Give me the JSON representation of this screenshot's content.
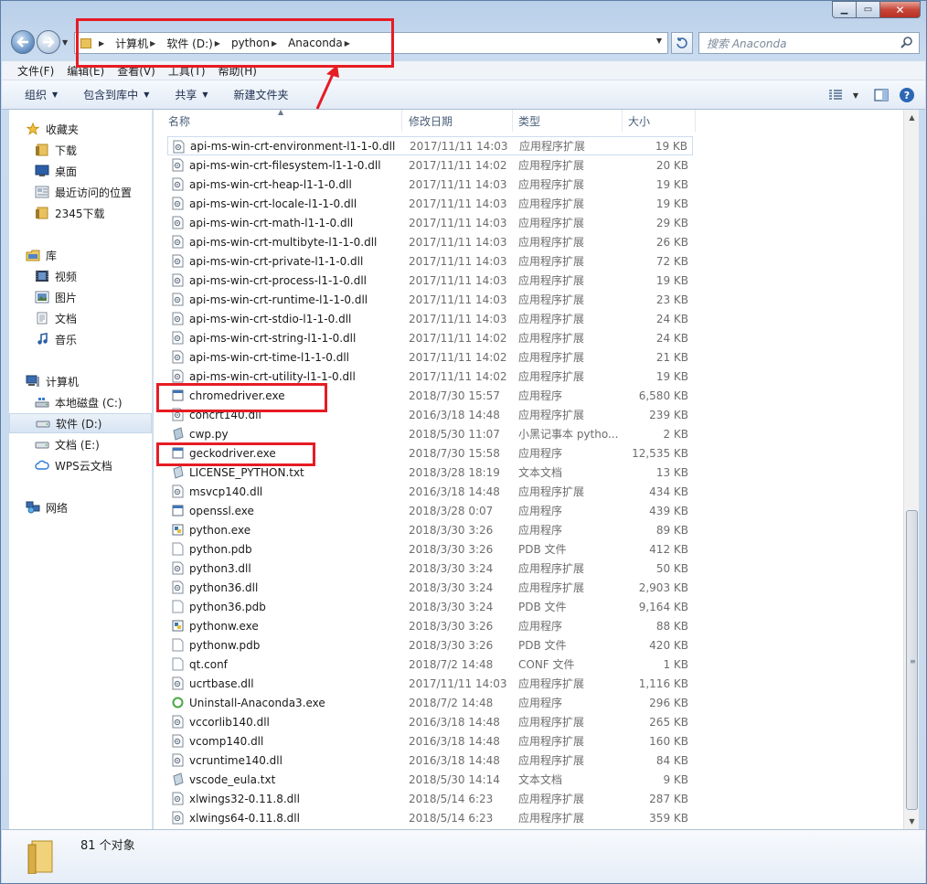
{
  "window": {
    "controls": {
      "minimize": "▁",
      "maximize": "▭",
      "close": "✕"
    }
  },
  "address": {
    "crumbs": [
      "计算机",
      "软件 (D:)",
      "python",
      "Anaconda"
    ],
    "search_placeholder": "搜索 Anaconda"
  },
  "menu": [
    "文件(F)",
    "编辑(E)",
    "查看(V)",
    "工具(T)",
    "帮助(H)"
  ],
  "commands": [
    "组织",
    "包含到库中",
    "共享",
    "新建文件夹"
  ],
  "nav": {
    "favorites": {
      "label": "收藏夹",
      "items": [
        "下载",
        "桌面",
        "最近访问的位置",
        "2345下载"
      ]
    },
    "library": {
      "label": "库",
      "items": [
        "视频",
        "图片",
        "文档",
        "音乐"
      ]
    },
    "computer": {
      "label": "计算机",
      "items": [
        "本地磁盘 (C:)",
        "软件 (D:)",
        "文档 (E:)",
        "WPS云文档"
      ]
    },
    "network": {
      "label": "网络"
    }
  },
  "columns": [
    "名称",
    "修改日期",
    "类型",
    "大小"
  ],
  "files": [
    {
      "name": "api-ms-win-crt-environment-l1-1-0.dll",
      "date": "2017/11/11 14:03",
      "type": "应用程序扩展",
      "size": "19 KB",
      "icon": "dll"
    },
    {
      "name": "api-ms-win-crt-filesystem-l1-1-0.dll",
      "date": "2017/11/11 14:02",
      "type": "应用程序扩展",
      "size": "20 KB",
      "icon": "dll"
    },
    {
      "name": "api-ms-win-crt-heap-l1-1-0.dll",
      "date": "2017/11/11 14:03",
      "type": "应用程序扩展",
      "size": "19 KB",
      "icon": "dll"
    },
    {
      "name": "api-ms-win-crt-locale-l1-1-0.dll",
      "date": "2017/11/11 14:03",
      "type": "应用程序扩展",
      "size": "19 KB",
      "icon": "dll"
    },
    {
      "name": "api-ms-win-crt-math-l1-1-0.dll",
      "date": "2017/11/11 14:03",
      "type": "应用程序扩展",
      "size": "29 KB",
      "icon": "dll"
    },
    {
      "name": "api-ms-win-crt-multibyte-l1-1-0.dll",
      "date": "2017/11/11 14:03",
      "type": "应用程序扩展",
      "size": "26 KB",
      "icon": "dll"
    },
    {
      "name": "api-ms-win-crt-private-l1-1-0.dll",
      "date": "2017/11/11 14:03",
      "type": "应用程序扩展",
      "size": "72 KB",
      "icon": "dll"
    },
    {
      "name": "api-ms-win-crt-process-l1-1-0.dll",
      "date": "2017/11/11 14:03",
      "type": "应用程序扩展",
      "size": "19 KB",
      "icon": "dll"
    },
    {
      "name": "api-ms-win-crt-runtime-l1-1-0.dll",
      "date": "2017/11/11 14:03",
      "type": "应用程序扩展",
      "size": "23 KB",
      "icon": "dll"
    },
    {
      "name": "api-ms-win-crt-stdio-l1-1-0.dll",
      "date": "2017/11/11 14:03",
      "type": "应用程序扩展",
      "size": "24 KB",
      "icon": "dll"
    },
    {
      "name": "api-ms-win-crt-string-l1-1-0.dll",
      "date": "2017/11/11 14:02",
      "type": "应用程序扩展",
      "size": "24 KB",
      "icon": "dll"
    },
    {
      "name": "api-ms-win-crt-time-l1-1-0.dll",
      "date": "2017/11/11 14:02",
      "type": "应用程序扩展",
      "size": "21 KB",
      "icon": "dll"
    },
    {
      "name": "api-ms-win-crt-utility-l1-1-0.dll",
      "date": "2017/11/11 14:02",
      "type": "应用程序扩展",
      "size": "19 KB",
      "icon": "dll"
    },
    {
      "name": "chromedriver.exe",
      "date": "2018/7/30 15:57",
      "type": "应用程序",
      "size": "6,580 KB",
      "icon": "exe"
    },
    {
      "name": "concrt140.dll",
      "date": "2016/3/18 14:48",
      "type": "应用程序扩展",
      "size": "239 KB",
      "icon": "dll"
    },
    {
      "name": "cwp.py",
      "date": "2018/5/30 11:07",
      "type": "小黑记事本 pytho...",
      "size": "2 KB",
      "icon": "py"
    },
    {
      "name": "geckodriver.exe",
      "date": "2018/7/30 15:58",
      "type": "应用程序",
      "size": "12,535 KB",
      "icon": "exe"
    },
    {
      "name": "LICENSE_PYTHON.txt",
      "date": "2018/3/28 18:19",
      "type": "文本文档",
      "size": "13 KB",
      "icon": "txt"
    },
    {
      "name": "msvcp140.dll",
      "date": "2016/3/18 14:48",
      "type": "应用程序扩展",
      "size": "434 KB",
      "icon": "dll"
    },
    {
      "name": "openssl.exe",
      "date": "2018/3/28 0:07",
      "type": "应用程序",
      "size": "439 KB",
      "icon": "exe"
    },
    {
      "name": "python.exe",
      "date": "2018/3/30 3:26",
      "type": "应用程序",
      "size": "89 KB",
      "icon": "pyexe"
    },
    {
      "name": "python.pdb",
      "date": "2018/3/30 3:26",
      "type": "PDB 文件",
      "size": "412 KB",
      "icon": "blank"
    },
    {
      "name": "python3.dll",
      "date": "2018/3/30 3:24",
      "type": "应用程序扩展",
      "size": "50 KB",
      "icon": "dll"
    },
    {
      "name": "python36.dll",
      "date": "2018/3/30 3:24",
      "type": "应用程序扩展",
      "size": "2,903 KB",
      "icon": "dll"
    },
    {
      "name": "python36.pdb",
      "date": "2018/3/30 3:24",
      "type": "PDB 文件",
      "size": "9,164 KB",
      "icon": "blank"
    },
    {
      "name": "pythonw.exe",
      "date": "2018/3/30 3:26",
      "type": "应用程序",
      "size": "88 KB",
      "icon": "pyexe"
    },
    {
      "name": "pythonw.pdb",
      "date": "2018/3/30 3:26",
      "type": "PDB 文件",
      "size": "420 KB",
      "icon": "blank"
    },
    {
      "name": "qt.conf",
      "date": "2018/7/2 14:48",
      "type": "CONF 文件",
      "size": "1 KB",
      "icon": "blank"
    },
    {
      "name": "ucrtbase.dll",
      "date": "2017/11/11 14:03",
      "type": "应用程序扩展",
      "size": "1,116 KB",
      "icon": "dll"
    },
    {
      "name": "Uninstall-Anaconda3.exe",
      "date": "2018/7/2 14:48",
      "type": "应用程序",
      "size": "296 KB",
      "icon": "uninst"
    },
    {
      "name": "vccorlib140.dll",
      "date": "2016/3/18 14:48",
      "type": "应用程序扩展",
      "size": "265 KB",
      "icon": "dll"
    },
    {
      "name": "vcomp140.dll",
      "date": "2016/3/18 14:48",
      "type": "应用程序扩展",
      "size": "160 KB",
      "icon": "dll"
    },
    {
      "name": "vcruntime140.dll",
      "date": "2016/3/18 14:48",
      "type": "应用程序扩展",
      "size": "84 KB",
      "icon": "dll"
    },
    {
      "name": "vscode_eula.txt",
      "date": "2018/5/30 14:14",
      "type": "文本文档",
      "size": "9 KB",
      "icon": "txt"
    },
    {
      "name": "xlwings32-0.11.8.dll",
      "date": "2018/5/14 6:23",
      "type": "应用程序扩展",
      "size": "287 KB",
      "icon": "dll"
    },
    {
      "name": "xlwings64-0.11.8.dll",
      "date": "2018/5/14 6:23",
      "type": "应用程序扩展",
      "size": "359 KB",
      "icon": "dll"
    }
  ],
  "status": {
    "count": "81 个对象"
  },
  "colors": {
    "annotation_red": "#e61c24"
  }
}
